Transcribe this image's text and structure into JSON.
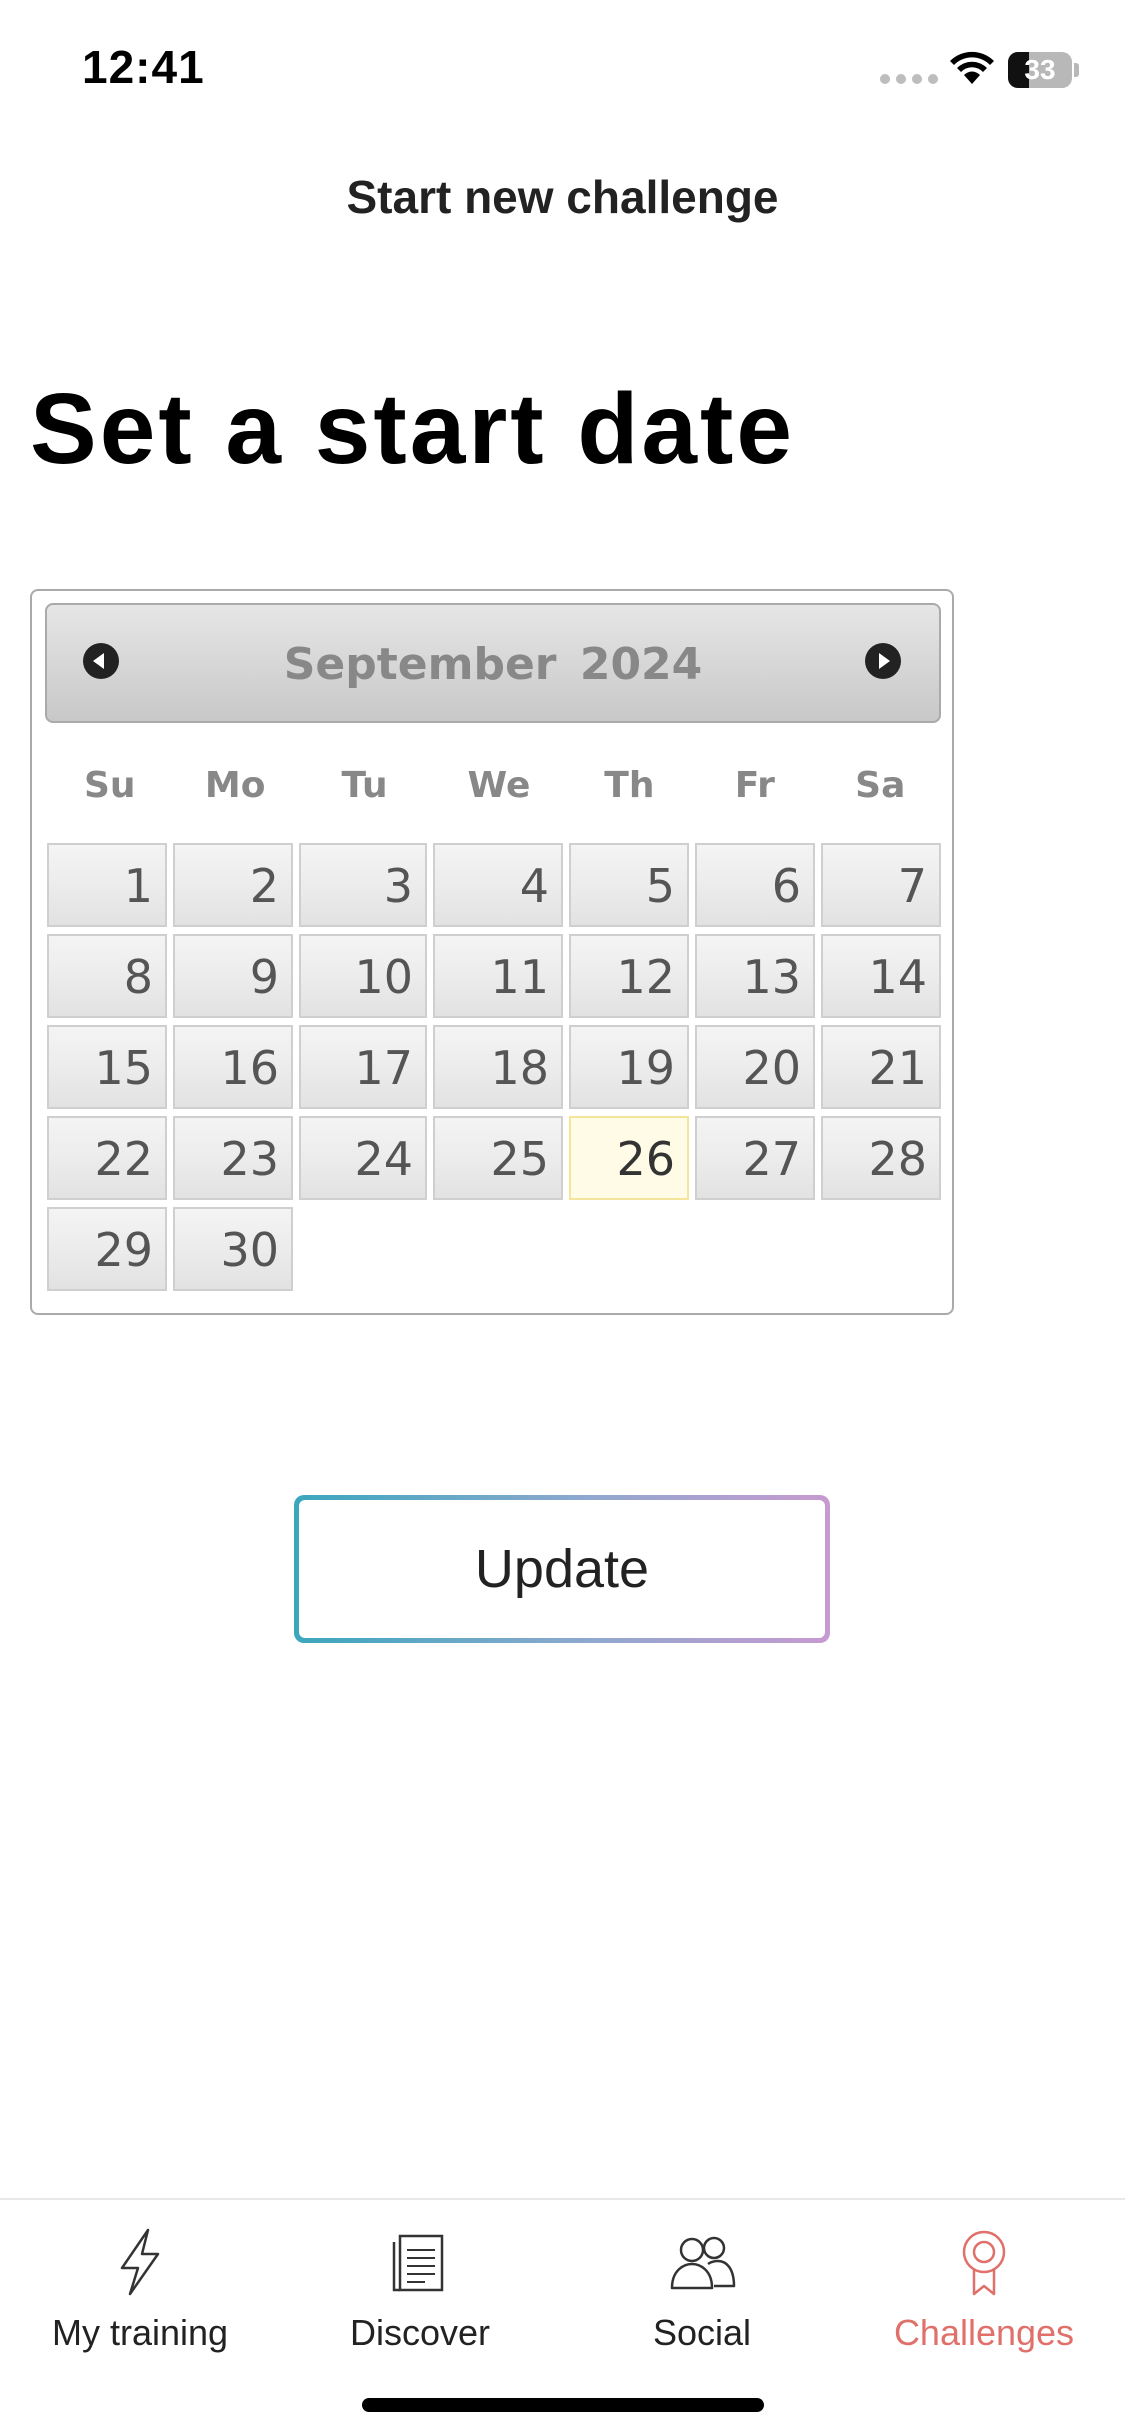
{
  "status_bar": {
    "time": "12:41",
    "battery": "33",
    "battery_level": 0.33
  },
  "header": {
    "title": "Start new challenge"
  },
  "heading": "Set a start date",
  "calendar": {
    "month": "September",
    "year": "2024",
    "weekdays": [
      "Su",
      "Mo",
      "Tu",
      "We",
      "Th",
      "Fr",
      "Sa"
    ],
    "weeks": [
      [
        "1",
        "2",
        "3",
        "4",
        "5",
        "6",
        "7"
      ],
      [
        "8",
        "9",
        "10",
        "11",
        "12",
        "13",
        "14"
      ],
      [
        "15",
        "16",
        "17",
        "18",
        "19",
        "20",
        "21"
      ],
      [
        "22",
        "23",
        "24",
        "25",
        "26",
        "27",
        "28"
      ],
      [
        "29",
        "30"
      ]
    ],
    "today": "26",
    "prev_icon": "chevron-left-icon",
    "next_icon": "chevron-right-icon"
  },
  "update_button": {
    "label": "Update",
    "gradient": [
      "#3aa7bd",
      "#8fa8cf",
      "#c79ad0"
    ]
  },
  "tab_bar": {
    "active_color": "#e0706a",
    "tabs": [
      {
        "label": "My training",
        "icon": "lightning-icon",
        "active": false
      },
      {
        "label": "Discover",
        "icon": "article-icon",
        "active": false
      },
      {
        "label": "Social",
        "icon": "people-icon",
        "active": false
      },
      {
        "label": "Challenges",
        "icon": "medal-icon",
        "active": true
      }
    ]
  }
}
